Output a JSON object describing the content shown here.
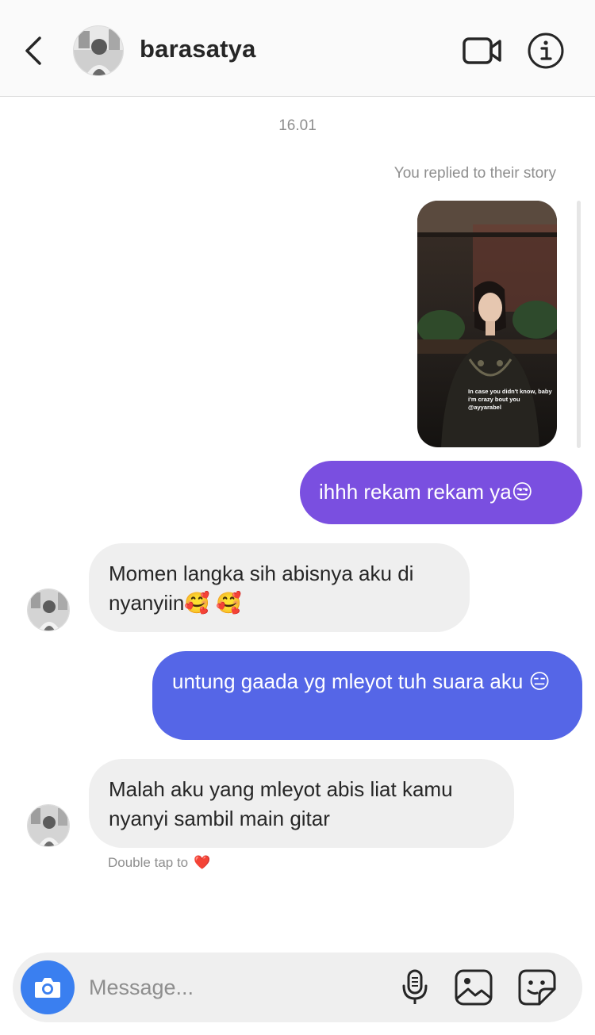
{
  "header": {
    "username": "barasatya",
    "icons": {
      "back": "chevron-left-icon",
      "video": "video-camera-icon",
      "info": "info-icon"
    }
  },
  "thread": {
    "timestamp": "16.01",
    "story_note": "You replied to their story",
    "story_caption": "In case you didn't know, baby i'm crazy bout you @ayyarabel",
    "messages": [
      {
        "sender": "me",
        "text": "ihhh rekam rekam ya😒",
        "color": "#7a4fe0"
      },
      {
        "sender": "them",
        "text": "Momen langka sih abisnya aku di nyanyiin🥰 🥰"
      },
      {
        "sender": "me",
        "text": "untung gaada yg mleyot tuh suara aku 😑",
        "color": "#5566e7"
      },
      {
        "sender": "them",
        "text": "Malah aku yang mleyot abis liat kamu nyanyi sambil main gitar"
      }
    ],
    "double_tap_label": "Double tap to",
    "double_tap_emoji": "❤️"
  },
  "composer": {
    "placeholder": "Message...",
    "value": "",
    "icons": {
      "camera": "camera-icon",
      "mic": "microphone-icon",
      "gallery": "image-icon",
      "sticker": "sticker-icon"
    },
    "camera_color": "#3a7ff0"
  }
}
